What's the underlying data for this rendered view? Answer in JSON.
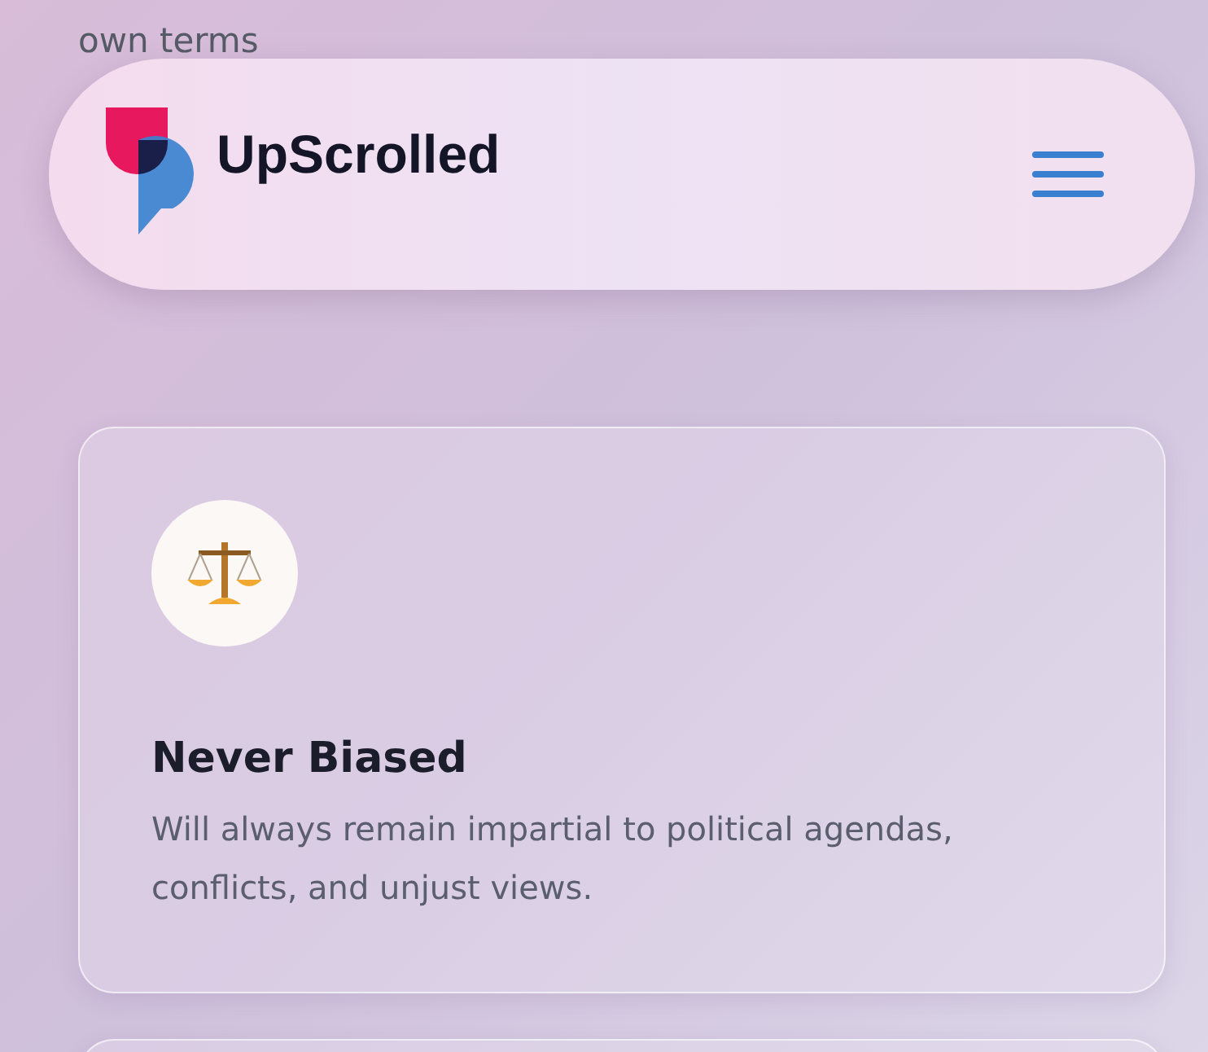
{
  "intro_text": "own terms",
  "header": {
    "brand": "UpScrolled"
  },
  "cards": [
    {
      "title": "Never Biased",
      "description": "Will always remain impartial to political agendas, conflicts, and unjust views."
    }
  ]
}
